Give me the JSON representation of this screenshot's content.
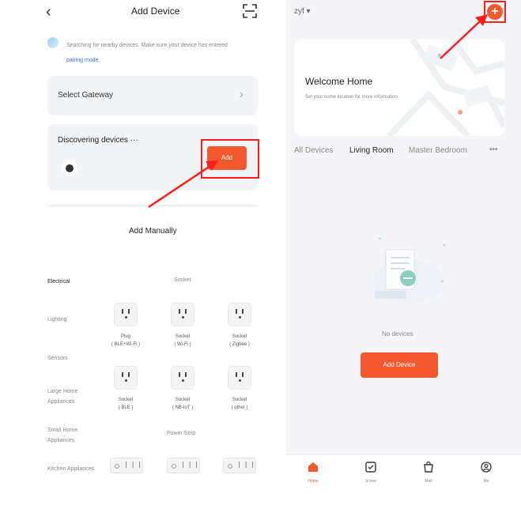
{
  "left": {
    "header": {
      "back": "‹",
      "title": "Add Device"
    },
    "hint": {
      "text": "Searching for nearby devices. Make sure your device has entered",
      "link": "pairing mode."
    },
    "gateway": {
      "label": "Select Gateway",
      "chevron": "›"
    },
    "discovering": {
      "label": "Discovering devices ···",
      "add_label": "Add"
    },
    "add_manually": "Add Manually",
    "categories": [
      "Electrical",
      "Lighting",
      "Sensors",
      "Large Home Appliances",
      "Small Home Appliances",
      "Kitchen Appliances"
    ],
    "socket_group": {
      "title": "Socket",
      "items": [
        {
          "name": "Plug",
          "sub": "( BLE+Wi-Fi )"
        },
        {
          "name": "Socket",
          "sub": "( Wi-Fi )"
        },
        {
          "name": "Socket",
          "sub": "( Zigbee )"
        },
        {
          "name": "Socket",
          "sub": "( BLE )"
        },
        {
          "name": "Socket",
          "sub": "( NB-IoT )"
        },
        {
          "name": "Socket",
          "sub": "( other )"
        }
      ]
    },
    "strip_group": {
      "title": "Power Strip"
    }
  },
  "right": {
    "header": {
      "user": "zyf ▾",
      "plus": "+"
    },
    "home": {
      "title": "Welcome Home",
      "subtitle": "Set your home location for more information"
    },
    "tabs": {
      "all": "All Devices",
      "living": "Living Room",
      "master": "Master Bedroom",
      "more": "•••"
    },
    "empty": {
      "text": "No devices",
      "button": "Add Device"
    },
    "tabbar": {
      "home": "Home",
      "scene": "Scene",
      "mall": "Mall",
      "me": "Me"
    }
  },
  "colors": {
    "accent": "#f2592d",
    "highlight": "#ff1e1e"
  }
}
